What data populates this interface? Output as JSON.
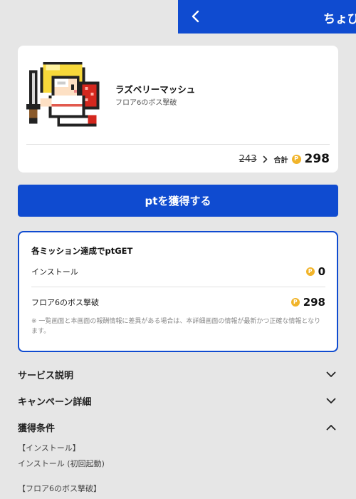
{
  "header": {
    "title": "ちょび",
    "back_icon": "chevron-left-icon",
    "background": "#0f4bd0"
  },
  "item": {
    "name": "ラズベリーマッシュ",
    "subtitle": "フロア6のボス撃破",
    "thumbnail_icon": "pixel-knight-character-image",
    "old_price": "243",
    "total_label": "合計",
    "coin_symbol": "P",
    "total_points": "298"
  },
  "cta": {
    "label": "ptを獲得する",
    "color": "#0f4bd0"
  },
  "missions": {
    "title": "各ミッション達成でptGET",
    "rows": [
      {
        "label": "インストール",
        "points": "0"
      },
      {
        "label": "フロア6のボス撃破",
        "points": "298"
      }
    ],
    "note": "※ 一覧画面と本画面の報酬情報に差異がある場合は、本詳細画面の情報が最新かつ正確な情報となります。"
  },
  "accordions": [
    {
      "label": "サービス説明",
      "expanded": false
    },
    {
      "label": "キャンペーン詳細",
      "expanded": false
    },
    {
      "label": "獲得条件",
      "expanded": true
    }
  ],
  "conditions": [
    "【インストール】",
    "インストール (初回起動)",
    "【フロア6のボス撃破】"
  ],
  "colors": {
    "accent": "#0f4bd0",
    "coin": "#f1b42a",
    "page_background": "#e6e6e6"
  }
}
